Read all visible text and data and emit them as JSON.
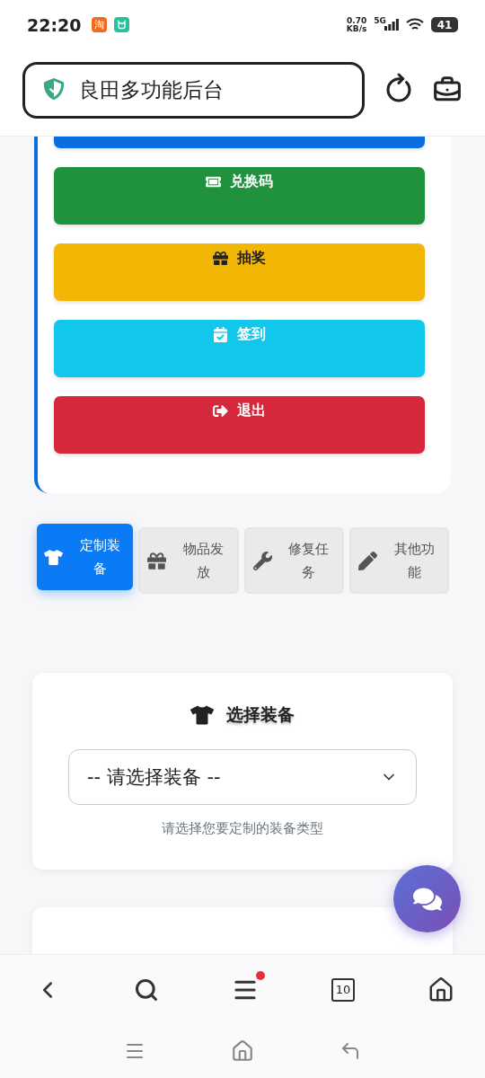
{
  "status_bar": {
    "time": "22:20",
    "app_badge": "淘",
    "net_speed": "0.70",
    "net_unit": "KB/s",
    "network": "5G",
    "battery": "41"
  },
  "header": {
    "title": "良田多功能后台"
  },
  "action_buttons": [
    {
      "kind": "partial",
      "color": "#0a6ee0"
    },
    {
      "kind": "full",
      "label": "兑换码",
      "color": "#20913c"
    },
    {
      "kind": "full",
      "label": "抽奖",
      "color": "#f2b705"
    },
    {
      "kind": "full",
      "label": "签到",
      "color": "#11c8ec"
    },
    {
      "kind": "full",
      "label": "退出",
      "color": "#d5283d"
    }
  ],
  "tabs": [
    {
      "label": "定制装备",
      "selected": true
    },
    {
      "label": "物品发放",
      "selected": false
    },
    {
      "label": "修复任务",
      "selected": false
    },
    {
      "label": "其他功能",
      "selected": false
    }
  ],
  "equipment_card": {
    "title": "选择装备",
    "select": {
      "value": "-- 请选择装备 --"
    },
    "help": "请选择您要定制的装备类型"
  },
  "browser_bar": {
    "tab_count": "10",
    "menu_notification": true
  }
}
